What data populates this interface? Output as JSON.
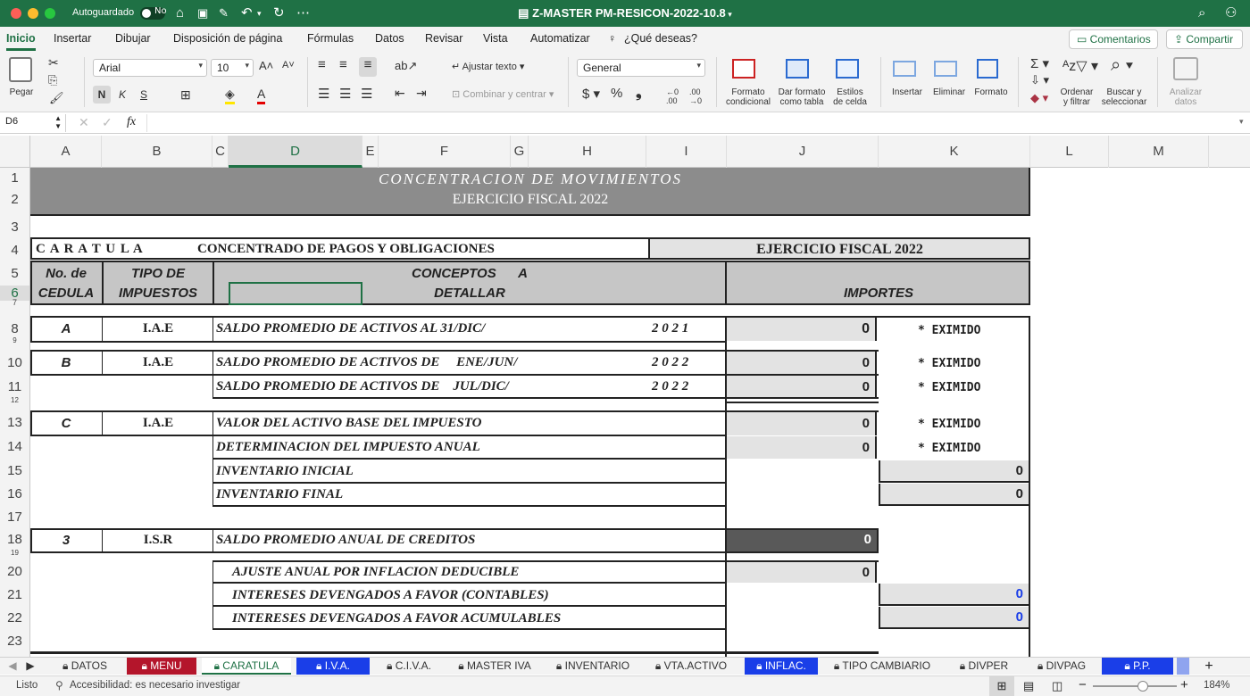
{
  "titlebar": {
    "autosave": "Autoguardado",
    "toggle": "No",
    "title": "Z-MASTER PM-RESICON-2022-10.8"
  },
  "menu": {
    "items": [
      "Inicio",
      "Insertar",
      "Dibujar",
      "Disposición de página",
      "Fórmulas",
      "Datos",
      "Revisar",
      "Vista",
      "Automatizar"
    ],
    "tell": "¿Qué deseas?",
    "comments": "Comentarios",
    "share": "Compartir"
  },
  "ribbon": {
    "paste": "Pegar",
    "font": "Arial",
    "size": "10",
    "bold": "N",
    "italic": "K",
    "underline": "S",
    "wrap": "Ajustar texto",
    "merge": "Combinar y centrar",
    "format": "General",
    "cond1": "Formato",
    "cond2": "condicional",
    "tbl1": "Dar formato",
    "tbl2": "como tabla",
    "sty1": "Estilos",
    "sty2": "de celda",
    "insert": "Insertar",
    "delete": "Eliminar",
    "formatc": "Formato",
    "sort1": "Ordenar",
    "sort2": "y filtrar",
    "find1": "Buscar y",
    "find2": "seleccionar",
    "an1": "Analizar",
    "an2": "datos"
  },
  "formula": {
    "cell": "D6",
    "fx": "fx",
    "value": ""
  },
  "columns": [
    "A",
    "B",
    "C",
    "D",
    "E",
    "F",
    "G",
    "H",
    "I",
    "J",
    "K",
    "L",
    "M"
  ],
  "rows": [
    "1",
    "2",
    "3",
    "4",
    "5",
    "6",
    "7",
    "8",
    "9",
    "10",
    "11",
    "12",
    "13",
    "14",
    "15",
    "16",
    "17",
    "18",
    "19",
    "20",
    "21",
    "22",
    "23"
  ],
  "sheet": {
    "title1": "CONCENTRACION  DE  MOVIMIENTOS",
    "title2": "EJERCICIO  FISCAL  2022",
    "caratula": "C A R A T U L A",
    "concentrado": "CONCENTRADO DE PAGOS Y OBLIGACIONES",
    "ejercicio": "EJERCICIO  FISCAL  2022",
    "h_cedula1": "No. de",
    "h_cedula2": "CEDULA",
    "h_tipo1": "TIPO DE",
    "h_tipo2": "IMPUESTOS",
    "h_conc1": "CONCEPTOS      A",
    "h_conc2": "DETALLAR",
    "h_imp": "IMPORTES",
    "r8": {
      "ced": "A",
      "tipo": "I.A.E",
      "concepto": "SALDO PROMEDIO DE ACTIVOS AL 31/DIC/",
      "year": "2 0 2 1",
      "valor": "0",
      "nota": "* EXIMIDO"
    },
    "r10": {
      "ced": "B",
      "tipo": "I.A.E",
      "concepto": "SALDO PROMEDIO DE ACTIVOS DE     ENE/JUN/",
      "year": "2 0 2 2",
      "valor": "0",
      "nota": "* EXIMIDO"
    },
    "r11": {
      "concepto": "SALDO PROMEDIO DE ACTIVOS DE    JUL/DIC/",
      "year": "2 0 2 2",
      "valor": "0",
      "nota": "* EXIMIDO"
    },
    "r13": {
      "ced": "C",
      "tipo": "I.A.E",
      "concepto": "VALOR DEL ACTIVO BASE DEL IMPUESTO",
      "valor": "0",
      "nota": "* EXIMIDO"
    },
    "r14": {
      "concepto": "DETERMINACION DEL IMPUESTO ANUAL",
      "valor": "0",
      "nota": "* EXIMIDO"
    },
    "r15": {
      "concepto": "INVENTARIO INICIAL",
      "valor": "0"
    },
    "r16": {
      "concepto": "INVENTARIO FINAL",
      "valor": "0"
    },
    "r18": {
      "ced": "3",
      "tipo": "I.S.R",
      "concepto": "SALDO PROMEDIO ANUAL DE CREDITOS",
      "valor": "0"
    },
    "r20": {
      "concepto": "AJUSTE ANUAL POR INFLACION DEDUCIBLE",
      "valor": "0"
    },
    "r21": {
      "concepto": "INTERESES DEVENGADOS A FAVOR (CONTABLES)",
      "valor": "0"
    },
    "r22": {
      "concepto": "INTERESES DEVENGADOS A FAVOR ACUMULABLES",
      "valor": "0"
    }
  },
  "tabs": [
    "DATOS",
    "MENU",
    "CARATULA",
    "I.V.A.",
    "C.I.V.A.",
    "MASTER IVA",
    "INVENTARIO",
    "VTA.ACTIVO",
    "INFLAC.",
    "TIPO CAMBIARIO",
    "DIVPER",
    "DIVPAG",
    "P.P."
  ],
  "status": {
    "ready": "Listo",
    "access": "Accesibilidad: es necesario investigar",
    "zoom": "184%"
  },
  "colors": {
    "excel_green": "#1f7145",
    "title_gray": "#8c8c8c",
    "header_gray": "#c6c6c6",
    "light_gray": "#e3e3e3",
    "dark_cell": "#595959",
    "tab_red": "#b4152b",
    "tab_blue": "#1a3ee8"
  }
}
